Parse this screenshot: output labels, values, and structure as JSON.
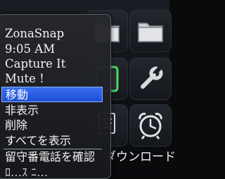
{
  "menu": {
    "items": [
      {
        "label": "ZonaSnap"
      },
      {
        "label": "9:05 AM"
      },
      {
        "label": "Capture It"
      },
      {
        "label": "Mute !"
      },
      {
        "label": "移動"
      },
      {
        "label": "非表示"
      },
      {
        "label": "削除"
      },
      {
        "label": "すべてを表示"
      },
      {
        "label": "留守番電話を確認"
      },
      {
        "label": "ﾛ…ｽ ﾆ…"
      }
    ],
    "selected_index": 4
  },
  "homescreen": {
    "icons": [
      {
        "name": "folder-icon"
      },
      {
        "name": "folder-icon"
      },
      {
        "name": "green-app-icon"
      },
      {
        "name": "wrench-icon"
      },
      {
        "name": "note-icon"
      },
      {
        "name": "alarm-clock-icon"
      }
    ],
    "bottom_label": "ダウンロード"
  },
  "colors": {
    "selection": "#2a5ee6",
    "menu_bg": "#1e2023",
    "text": "#f5f5f5"
  }
}
